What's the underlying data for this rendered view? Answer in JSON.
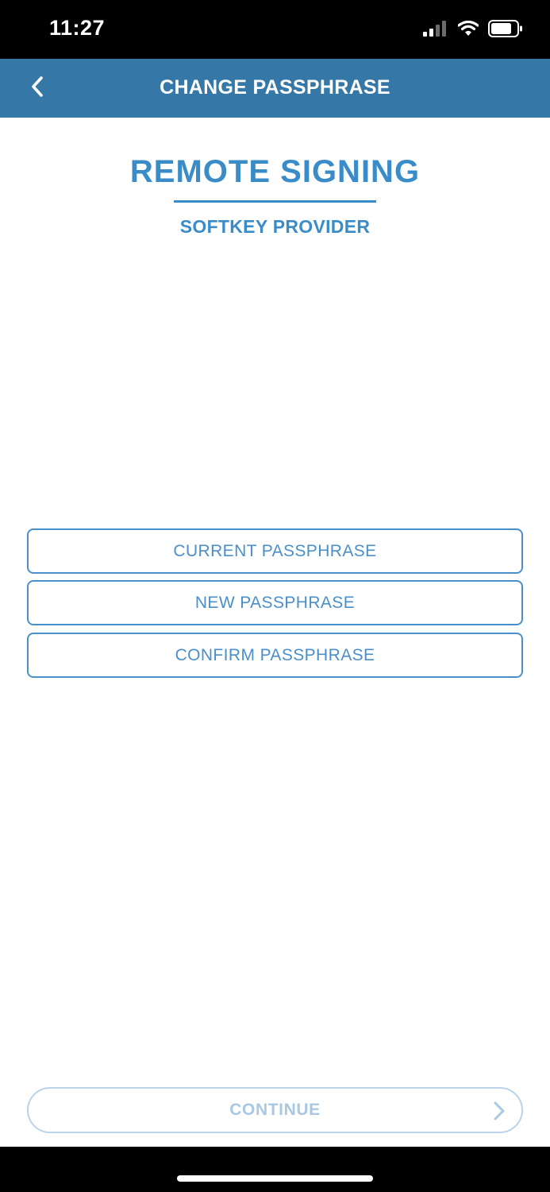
{
  "status_bar": {
    "time": "11:27",
    "icons": [
      "cellular-signal-icon",
      "wifi-icon",
      "battery-icon"
    ]
  },
  "nav": {
    "title": "CHANGE PASSPHRASE",
    "back_icon": "chevron-left-icon"
  },
  "header": {
    "title": "REMOTE SIGNING",
    "subtitle": "SOFTKEY PROVIDER"
  },
  "form": {
    "fields": [
      {
        "placeholder": "CURRENT PASSPHRASE",
        "value": ""
      },
      {
        "placeholder": "NEW PASSPHRASE",
        "value": ""
      },
      {
        "placeholder": "CONFIRM PASSPHRASE",
        "value": ""
      }
    ]
  },
  "continue": {
    "label": "CONTINUE",
    "icon": "chevron-right-icon"
  },
  "colors": {
    "nav_background": "#3577a6",
    "accent": "#3a8cc9",
    "field_border": "#4a8fca",
    "disabled_text": "#a9c8e3",
    "disabled_border": "#b8d3ea"
  }
}
